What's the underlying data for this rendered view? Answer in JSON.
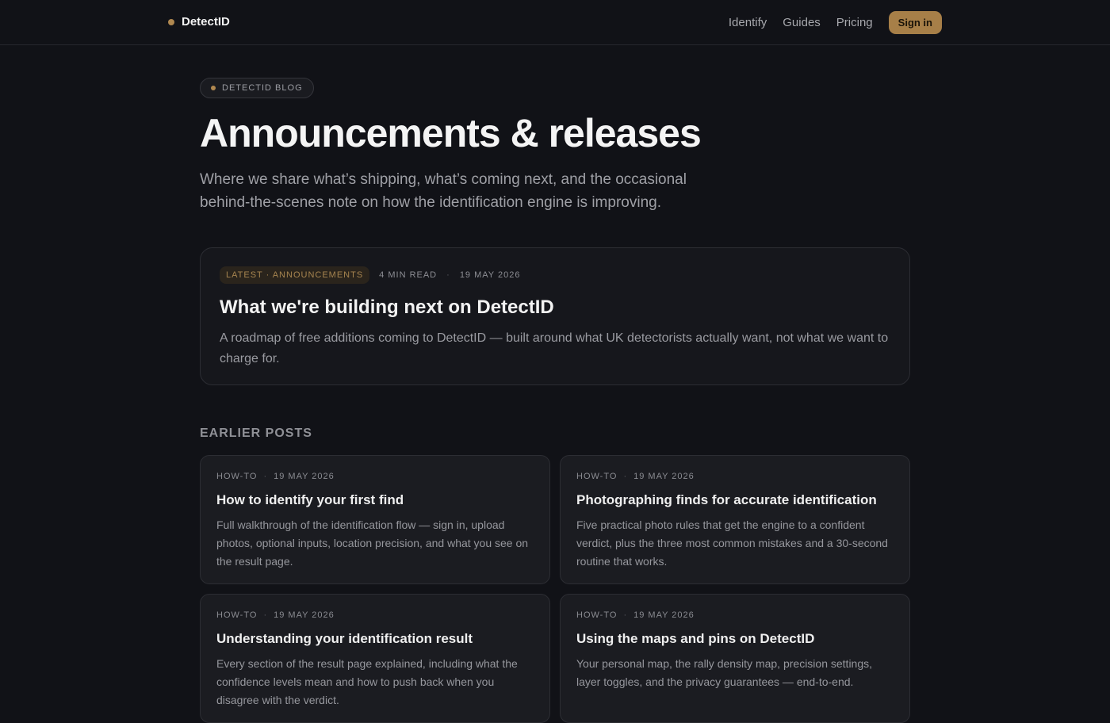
{
  "brand": {
    "name": "DetectID"
  },
  "nav": {
    "items": [
      "Identify",
      "Guides",
      "Pricing"
    ],
    "signin": "Sign in"
  },
  "hero": {
    "pill": "DETECTID BLOG",
    "title": "Announcements & releases",
    "lead": "Where we share what’s shipping, what’s coming next, and the occasional behind-the-scenes note on how the identification engine is improving."
  },
  "featured": {
    "tag": "LATEST · ANNOUNCEMENTS",
    "read": "4 MIN READ",
    "sep": "·",
    "date": "19 MAY 2026",
    "title": "What we're building next on DetectID",
    "excerpt": "A roadmap of free additions coming to DetectID — built around what UK detectorists actually want, not what we want to charge for."
  },
  "earlier": {
    "heading": "EARLIER POSTS",
    "posts": [
      {
        "category": "HOW-TO",
        "sep": "·",
        "date": "19 MAY 2026",
        "title": "How to identify your first find",
        "excerpt": "Full walkthrough of the identification flow — sign in, upload photos, optional inputs, location precision, and what you see on the result page."
      },
      {
        "category": "HOW-TO",
        "sep": "·",
        "date": "19 MAY 2026",
        "title": "Photographing finds for accurate identification",
        "excerpt": "Five practical photo rules that get the engine to a confident verdict, plus the three most common mistakes and a 30-second routine that works."
      },
      {
        "category": "HOW-TO",
        "sep": "·",
        "date": "19 MAY 2026",
        "title": "Understanding your identification result",
        "excerpt": "Every section of the result page explained, including what the confidence levels mean and how to push back when you disagree with the verdict."
      },
      {
        "category": "HOW-TO",
        "sep": "·",
        "date": "19 MAY 2026",
        "title": "Using the maps and pins on DetectID",
        "excerpt": "Your personal map, the rally density map, precision settings, layer toggles, and the privacy guarantees — end-to-end."
      }
    ]
  }
}
